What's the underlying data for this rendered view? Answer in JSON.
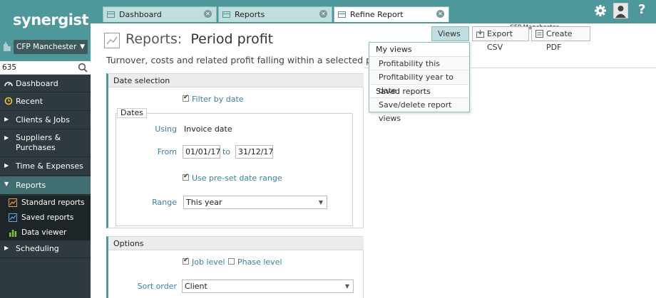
{
  "app": {
    "logo": "synergist",
    "office": "CFP Manchester",
    "search_value": "635"
  },
  "sidebar": {
    "items": [
      {
        "label": "Dashboard",
        "icon": "dashboard-icon"
      },
      {
        "label": "Recent",
        "icon": "recent-icon"
      },
      {
        "label": "Clients & Jobs",
        "icon": "chevron-right-icon"
      },
      {
        "label": "Suppliers & Purchases",
        "icon": "chevron-right-icon"
      },
      {
        "label": "Time & Expenses",
        "icon": "chevron-right-icon"
      },
      {
        "label": "Reports",
        "icon": "chevron-down-icon"
      },
      {
        "label": "Scheduling",
        "icon": "chevron-right-icon"
      }
    ],
    "reports_sub": [
      {
        "label": "Standard reports",
        "icon": "standard-reports-icon"
      },
      {
        "label": "Saved reports",
        "icon": "saved-reports-icon"
      },
      {
        "label": "Data viewer",
        "icon": "data-viewer-icon"
      }
    ]
  },
  "tabs": [
    {
      "label": "Dashboard",
      "active": false
    },
    {
      "label": "Reports",
      "active": false
    },
    {
      "label": "Refine Report",
      "active": true
    }
  ],
  "topbar": {
    "office_label": "CFP Manchester",
    "help_glyph": "?"
  },
  "header": {
    "title_prefix": "Reports:",
    "title": "Period profit",
    "subtitle": "Turnover, costs and related profit falling within a selected period",
    "views_label": "Views",
    "export_label": "Export CSV",
    "pdf_label": "Create PDF"
  },
  "views_menu": {
    "my_views": "My views",
    "items_my": [
      "Profitability this quarter",
      "Profitability year to date"
    ],
    "saved_reports": "Saved reports",
    "items_saved": [
      "Save/delete report views"
    ]
  },
  "date_selection": {
    "heading": "Date selection",
    "filter_by_date": "Filter by date",
    "filter_checked": true,
    "dates_legend": "Dates",
    "using_label": "Using",
    "using_value": "Invoice date",
    "from_label": "From",
    "from_value": "01/01/17",
    "to_label": "to",
    "to_value": "31/12/17",
    "preset_label": "Use pre-set date range",
    "preset_checked": true,
    "range_label": "Range",
    "range_value": "This year"
  },
  "options": {
    "heading": "Options",
    "job_level": "Job level",
    "job_checked": true,
    "phase_level": "Phase level",
    "phase_checked": false,
    "sort_label": "Sort order",
    "sort_value": "Client"
  },
  "colors": {
    "brand_teal": "#4e979a",
    "sidebar_dark": "#2f3a40",
    "tab_bg": "#bfdedd",
    "link_blue": "#3a7fa0"
  }
}
